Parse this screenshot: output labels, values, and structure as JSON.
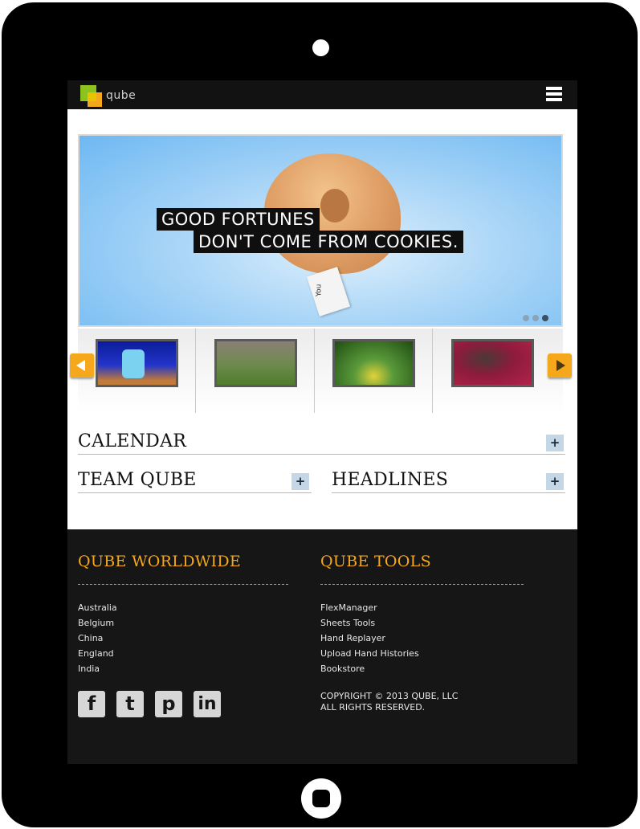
{
  "header": {
    "logo_text": "qube",
    "menu_icon": "hamburger-menu-icon"
  },
  "hero": {
    "line1": "GOOD FORTUNES",
    "line2": "DON'T COME FROM COOKIES.",
    "paper_text": "You",
    "slides": 3,
    "active_slide": 3
  },
  "thumbnails": [
    {
      "label": "robot on stage"
    },
    {
      "label": "group outdoors"
    },
    {
      "label": "insect on flower"
    },
    {
      "label": "board game table"
    }
  ],
  "sections": {
    "calendar": "CALENDAR",
    "team": "TEAM QUBE",
    "headlines": "HEADLINES",
    "expand_label": "+"
  },
  "footer": {
    "worldwide_title": "QUBE WORLDWIDE",
    "worldwide": [
      "Australia",
      "Belgium",
      "China",
      "England",
      "India"
    ],
    "tools_title": "QUBE TOOLS",
    "tools": [
      "FlexManager",
      "Sheets Tools",
      "Hand Replayer",
      "Upload Hand Histories",
      "Bookstore"
    ],
    "social": {
      "facebook": "f",
      "twitter": "t",
      "pinterest": "p",
      "linkedin": "in"
    },
    "copyright_line1": "COPYRIGHT © 2013 QUBE, LLC",
    "copyright_line2": "ALL RIGHTS RESERVED."
  },
  "colors": {
    "accent": "#f5a81c",
    "logo_green": "#8dc21f",
    "footer_bg": "#161616",
    "plus_bg": "#c5d6e6"
  }
}
